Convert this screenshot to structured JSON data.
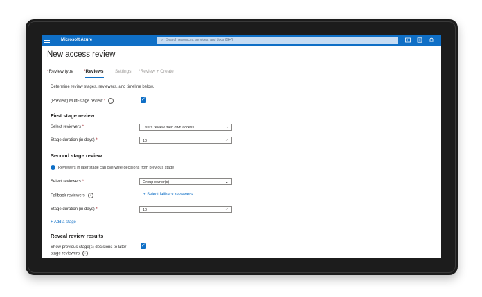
{
  "topbar": {
    "brand": "Microsoft Azure",
    "search_placeholder": "Search resources, services, and docs (G+/)",
    "icons": [
      "menu-icon",
      "cloud-shell-icon",
      "directory-filter-icon",
      "notifications-icon"
    ]
  },
  "page": {
    "title": "New access review",
    "ellipsis": "···"
  },
  "tabs": [
    {
      "label": "Review type",
      "required": "*",
      "state": "normal"
    },
    {
      "label": "Reviews",
      "required": "*",
      "state": "active"
    },
    {
      "label": "Settings",
      "required": "",
      "state": "disabled"
    },
    {
      "label": "Review + Create",
      "required": "*",
      "state": "disabled"
    }
  ],
  "intro": "Determine review stages, reviewers, and timeline below.",
  "multistage": {
    "label": "(Preview) Multi-stage review",
    "required": "*",
    "checked": true
  },
  "first_stage": {
    "heading": "First stage review",
    "reviewers_label": "Select reviewers",
    "reviewers_value": "Users review their own access",
    "duration_label": "Stage duration (in days)",
    "duration_value": "10",
    "required": "*"
  },
  "second_stage": {
    "heading": "Second stage review",
    "notice": "Reviewers in later stage can overwrite decisions from previous stage",
    "reviewers_label": "Select reviewers",
    "reviewers_value": "Group owner(s)",
    "fallback_label": "Fallback reviewers",
    "fallback_link": "+ Select fallback reviewers",
    "duration_label": "Stage duration (in days)",
    "duration_value": "10",
    "required": "*"
  },
  "add_stage": "+ Add a stage",
  "reveal": {
    "heading": "Reveal review results",
    "label_line1": "Show previous stage(s) decisions to later",
    "label_line2": "stage reviewers",
    "checked": true
  },
  "colors": {
    "accent": "#0f6fc6",
    "required": "#a4262c"
  }
}
